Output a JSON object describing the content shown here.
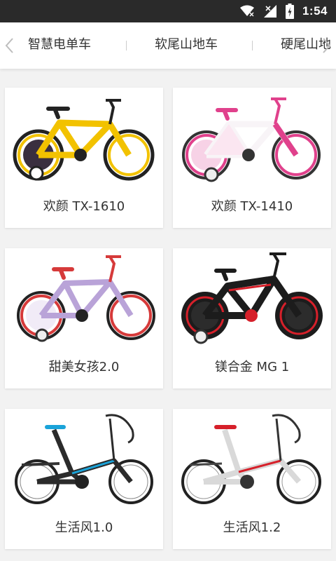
{
  "status_bar": {
    "time": "1:54",
    "icons": [
      "wifi-icon",
      "signal-icon",
      "battery-icon"
    ]
  },
  "tabs": {
    "items": [
      {
        "label": "智慧电单车"
      },
      {
        "label": "软尾山地车"
      },
      {
        "label": "硬尾山地"
      }
    ]
  },
  "products": [
    {
      "name": "欢颜 TX-1610",
      "frame_color": "#f2c200",
      "accent_color": "#222222"
    },
    {
      "name": "欢颜 TX-1410",
      "frame_color": "#ffffff",
      "accent_color": "#e0418c"
    },
    {
      "name": "甜美女孩2.0",
      "frame_color": "#b9a3d8",
      "accent_color": "#d63a3a"
    },
    {
      "name": "镁合金 MG 1",
      "frame_color": "#1c1c1c",
      "accent_color": "#d6202a"
    },
    {
      "name": "生活风1.0",
      "frame_color": "#2b2b2b",
      "accent_color": "#1aa3d9"
    },
    {
      "name": "生活风1.2",
      "frame_color": "#f4f4f4",
      "accent_color": "#d6202a"
    }
  ]
}
